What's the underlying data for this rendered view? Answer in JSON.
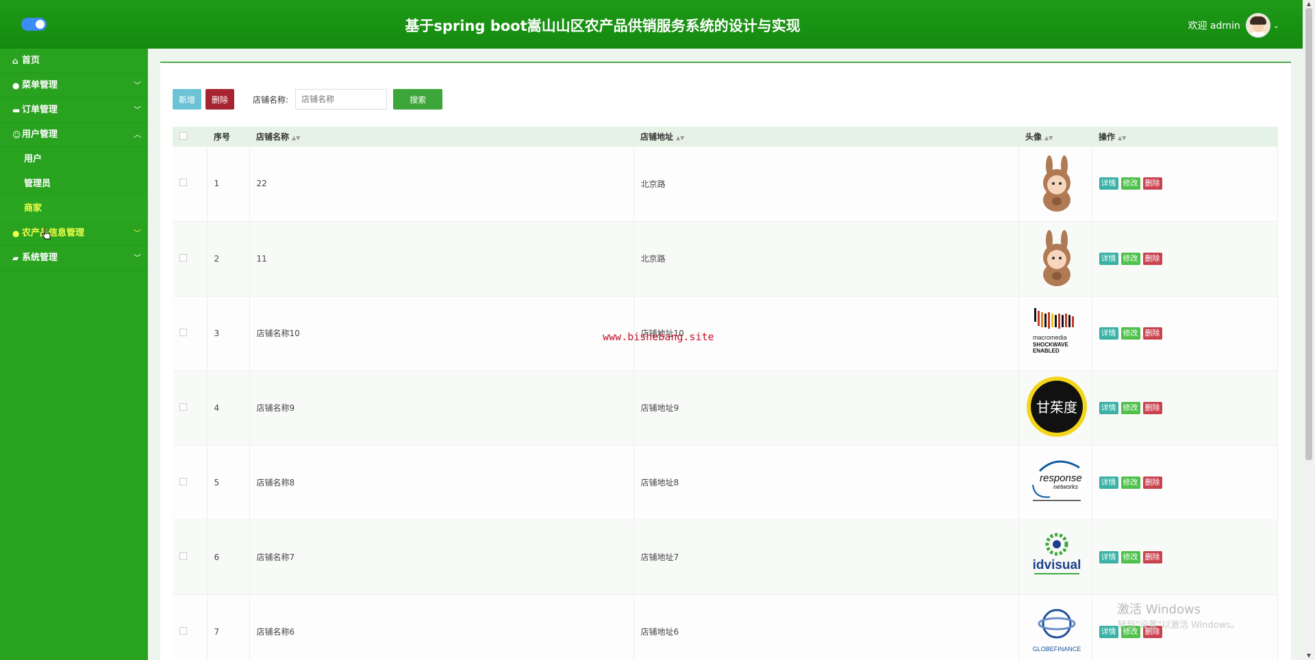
{
  "header": {
    "title": "基于spring boot嵩山山区农产品供销服务系统的设计与实现",
    "welcome": "欢迎 admin"
  },
  "sidebar": {
    "items": [
      {
        "label": "首页",
        "icon": "home-icon"
      },
      {
        "label": "菜单管理",
        "icon": "grid-icon"
      },
      {
        "label": "订单管理",
        "icon": "wallet-icon"
      },
      {
        "label": "用户管理",
        "icon": "user-icon"
      },
      {
        "label": "农产品信息管理",
        "icon": "circle-icon"
      },
      {
        "label": "系统管理",
        "icon": "briefcase-icon"
      }
    ],
    "subitems": [
      {
        "label": "用户"
      },
      {
        "label": "管理员"
      },
      {
        "label": "商家"
      }
    ]
  },
  "toolbar": {
    "add_label": "新增",
    "delete_label": "删除",
    "search_label": "店铺名称:",
    "search_placeholder": "店铺名称",
    "search_button": "搜索"
  },
  "table": {
    "columns": [
      "序号",
      "店铺名称",
      "店铺地址",
      "头像",
      "操作"
    ],
    "rows": [
      {
        "no": "1",
        "name": "22",
        "address": "北京路",
        "avatar": "kangaroo-costume-icon"
      },
      {
        "no": "2",
        "name": "11",
        "address": "北京路",
        "avatar": "kangaroo-costume-icon"
      },
      {
        "no": "3",
        "name": "店铺名称10",
        "address": "店铺地址10",
        "avatar": "macromedia-shockwave-logo"
      },
      {
        "no": "4",
        "name": "店铺名称9",
        "address": "店铺地址9",
        "avatar": "circle-text-logo"
      },
      {
        "no": "5",
        "name": "店铺名称8",
        "address": "店铺地址8",
        "avatar": "response-networks-logo"
      },
      {
        "no": "6",
        "name": "店铺名称7",
        "address": "店铺地址7",
        "avatar": "idvisual-logo"
      },
      {
        "no": "7",
        "name": "店铺名称6",
        "address": "店铺地址6",
        "avatar": "globefinance-logo"
      }
    ],
    "ops": {
      "view": "详情",
      "edit": "修改",
      "delete": "删除"
    }
  },
  "logos": {
    "macromedia": [
      "macromedia",
      "SHOCKWAVE",
      "ENABLED"
    ],
    "circle": "甘茱度",
    "response": [
      "response",
      "networks"
    ],
    "idvisual": "idvisual",
    "globe": "GLOBEFINANCE"
  },
  "overlay": {
    "watermark": "www.bishebang.site",
    "activate_title": "激活 Windows",
    "activate_sub": "转到\"设置\"以激活 Windows。"
  }
}
